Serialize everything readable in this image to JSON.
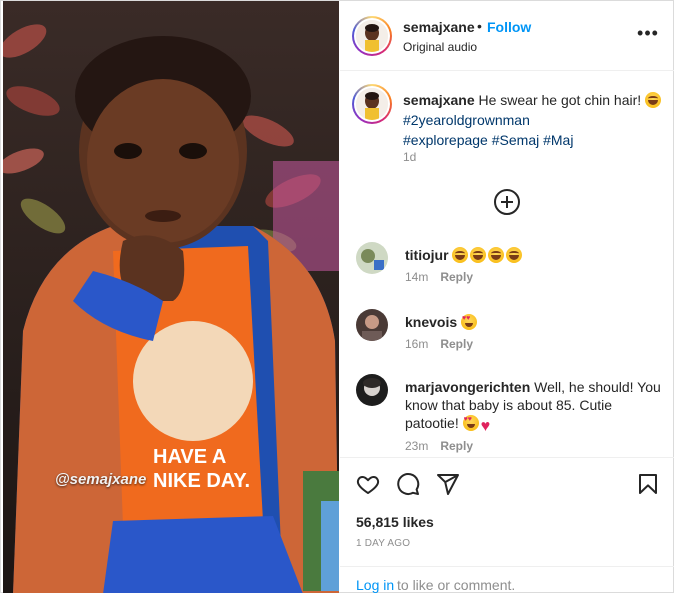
{
  "post": {
    "username": "semajxane",
    "separator": "•",
    "follow_label": "Follow",
    "audio": "Original audio",
    "more_label": "•••"
  },
  "caption": {
    "username": "semajxane",
    "text": "He swear he got chin hair!",
    "hashtags": [
      "#2yearoldgrownman",
      "#explorepage",
      "#Semaj",
      "#Maj"
    ],
    "time": "1d"
  },
  "comments": [
    {
      "username": "titiojur",
      "text": "",
      "emojis": [
        "laugh",
        "laugh",
        "laugh",
        "laugh"
      ],
      "time": "14m",
      "reply": "Reply"
    },
    {
      "username": "knevois",
      "text": "",
      "emojis": [
        "hearteyes"
      ],
      "time": "16m",
      "reply": "Reply"
    },
    {
      "username": "marjavongerichten",
      "text": "Well, he should! You know that baby is about 85. Cutie patootie!",
      "emojis": [
        "hearteyes",
        "heart"
      ],
      "time": "23m",
      "reply": "Reply"
    }
  ],
  "actions": {
    "likes": "56,815 likes",
    "posted": "1 DAY AGO",
    "login_link": "Log in",
    "login_rest": "to like or comment."
  },
  "media": {
    "watermark": "@semajxane"
  },
  "colors": {
    "accent": "#0095f6",
    "hashtag": "#00376b",
    "muted": "#8e8e8e"
  }
}
